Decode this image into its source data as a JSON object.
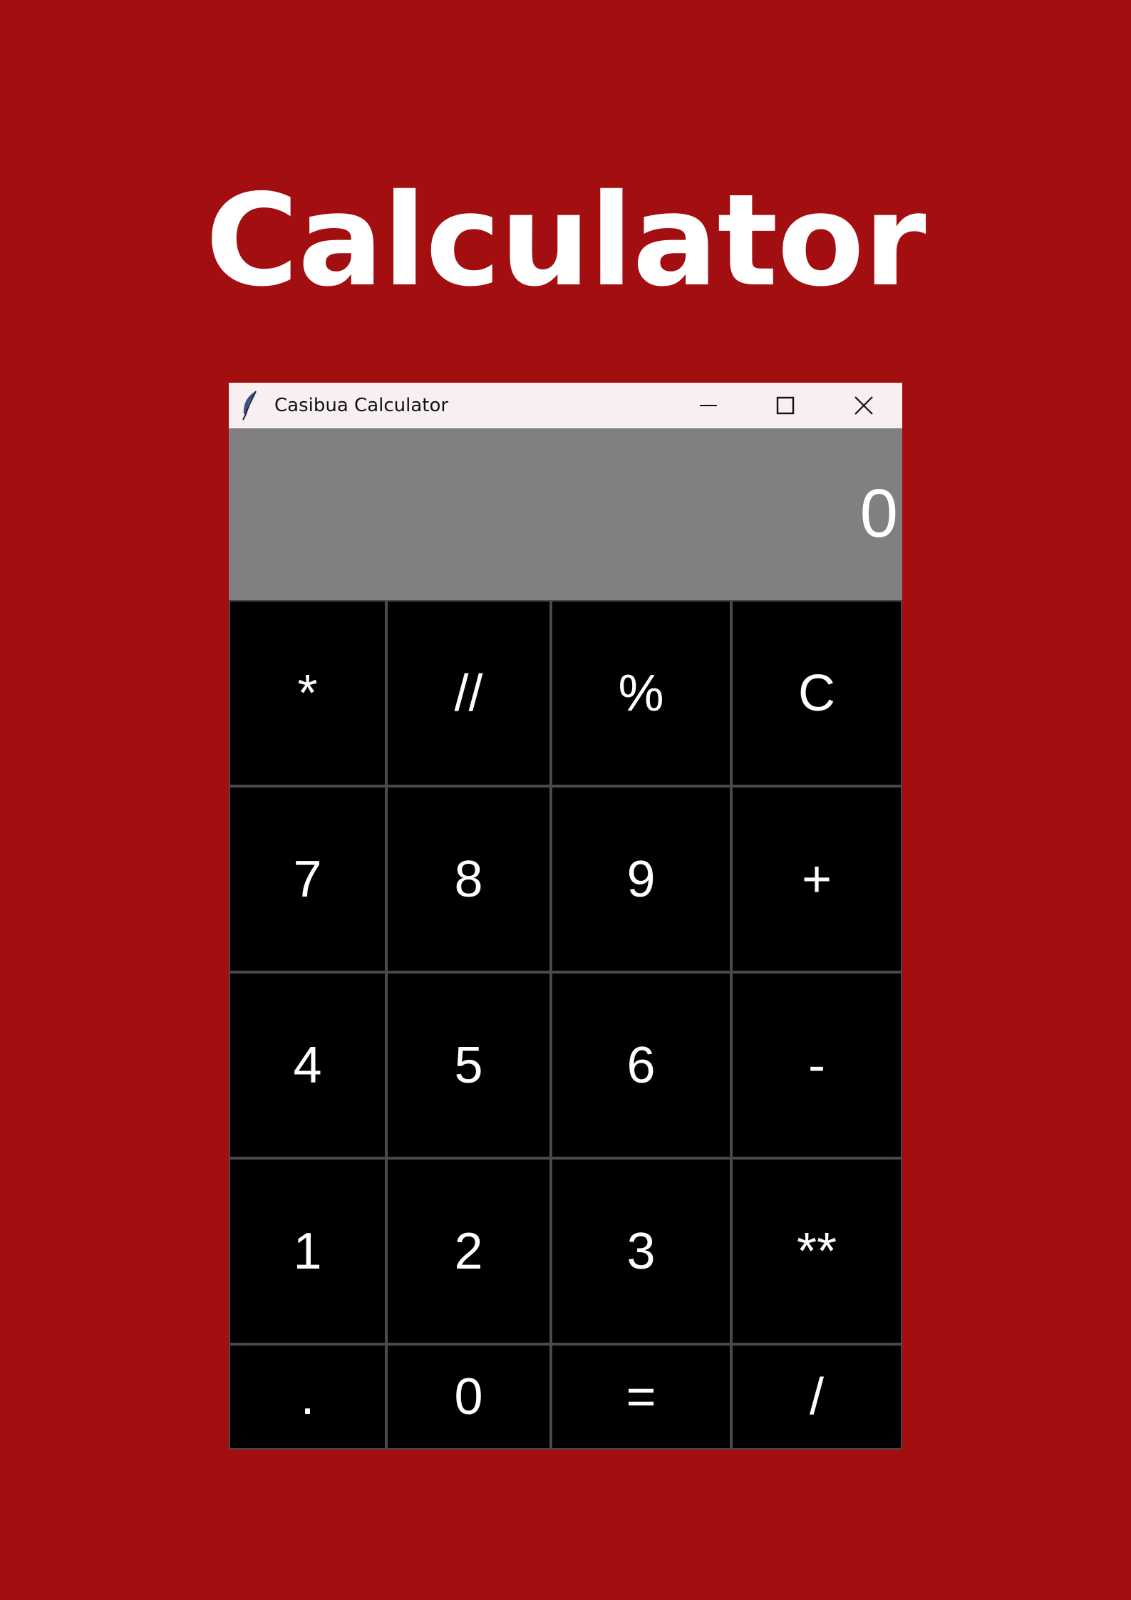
{
  "poster": {
    "title": "Calculator"
  },
  "window": {
    "title": "Casibua Calculator",
    "app_icon": "feather-icon",
    "controls": [
      "minimize-icon",
      "maximize-icon",
      "close-icon"
    ]
  },
  "display": {
    "value": "0"
  },
  "keypad": {
    "rows": [
      [
        "*",
        "//",
        "%",
        "C"
      ],
      [
        "7",
        "8",
        "9",
        "+"
      ],
      [
        "4",
        "5",
        "6",
        "-"
      ],
      [
        "1",
        "2",
        "3",
        "**"
      ],
      [
        ".",
        "0",
        "=",
        "/"
      ]
    ]
  },
  "colors": {
    "background": "#a30e10",
    "titlebar": "#f8eff0",
    "display": "#808080",
    "key": "#000000",
    "key_text": "#ffffff"
  }
}
